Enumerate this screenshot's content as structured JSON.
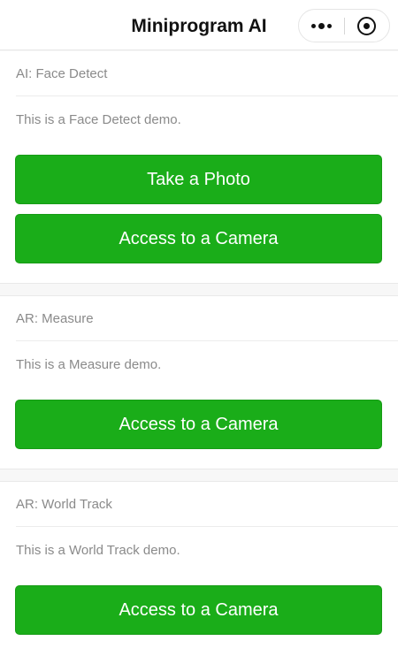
{
  "nav": {
    "title": "Miniprogram AI",
    "more_icon": "more-dots-icon",
    "close_icon": "close-target-icon"
  },
  "sections": [
    {
      "title": "AI: Face Detect",
      "description": "This is a Face Detect demo.",
      "buttons": [
        "Take a Photo",
        "Access to a Camera"
      ]
    },
    {
      "title": "AR: Measure",
      "description": "This is a Measure demo.",
      "buttons": [
        "Access to a Camera"
      ]
    },
    {
      "title": "AR: World Track",
      "description": "This is a World Track demo.",
      "buttons": [
        "Access to a Camera"
      ]
    }
  ],
  "colors": {
    "primary_button": "#1aad19",
    "page_background": "#f7f7f7",
    "muted_text": "#8a8a8a"
  }
}
